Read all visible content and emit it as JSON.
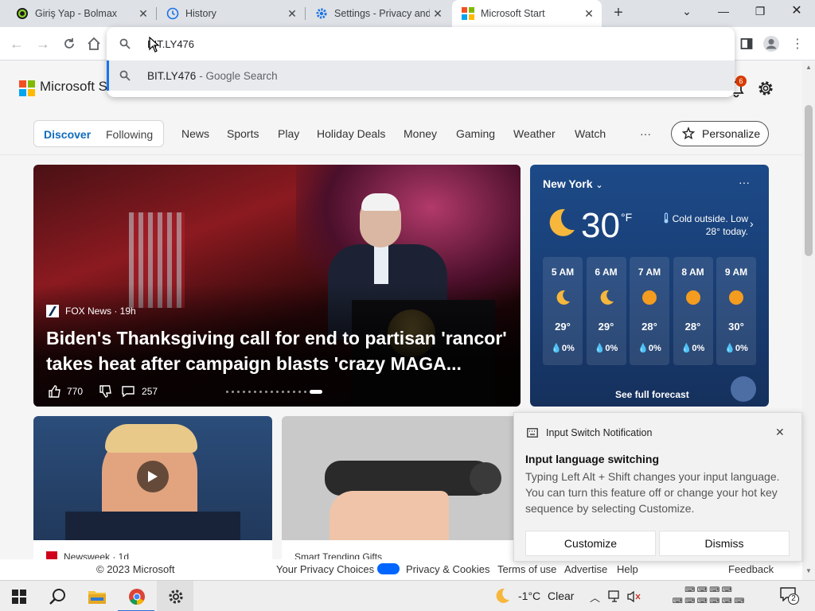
{
  "browser": {
    "tabs": [
      {
        "title": "Giriş Yap - Bolmax",
        "icon": "bolmax-icon"
      },
      {
        "title": "History",
        "icon": "history-icon"
      },
      {
        "title": "Settings - Privacy and",
        "icon": "settings-icon"
      },
      {
        "title": "Microsoft Start",
        "icon": "microsoft-icon",
        "active": true
      }
    ],
    "new_tab": "+",
    "omnibox": {
      "value": "BIT.LY476",
      "suggestion_main": "BIT.LY476",
      "suggestion_sub": "- Google Search"
    }
  },
  "page": {
    "brand": "Microsoft Start",
    "notification_count": "6",
    "nav": {
      "discover": "Discover",
      "following": "Following",
      "links": [
        "News",
        "Sports",
        "Play",
        "Holiday Deals",
        "Money",
        "Gaming",
        "Weather",
        "Watch"
      ],
      "more": "···",
      "personalize": "Personalize"
    },
    "hero": {
      "source": "FOX News · 19h",
      "title": "Biden's Thanksgiving call for end to partisan 'rancor' takes heat after campaign blasts 'crazy MAGA...",
      "likes": "770",
      "comments": "257"
    },
    "weather": {
      "city": "New York",
      "temp": "30",
      "unit": "°F",
      "description": "Cold outside. Low 28° today.",
      "hours": [
        {
          "time": "5 AM",
          "temp": "29°",
          "rain": "0%",
          "icon": "moon-icon"
        },
        {
          "time": "6 AM",
          "temp": "29°",
          "rain": "0%",
          "icon": "moon-icon"
        },
        {
          "time": "7 AM",
          "temp": "28°",
          "rain": "0%",
          "icon": "sun-icon"
        },
        {
          "time": "8 AM",
          "temp": "28°",
          "rain": "0%",
          "icon": "sun-icon"
        },
        {
          "time": "9 AM",
          "temp": "30°",
          "rain": "0%",
          "icon": "sun-icon"
        }
      ],
      "forecast_link": "See full forecast"
    },
    "cards": [
      {
        "source": "Newsweek · 1d"
      },
      {
        "source": "Smart Trending Gifts"
      }
    ],
    "footer": {
      "copyright": "© 2023 Microsoft",
      "privacy_choices": "Your Privacy Choices",
      "privacy_cookies": "Privacy & Cookies",
      "terms": "Terms of use",
      "advertise": "Advertise",
      "help": "Help",
      "feedback": "Feedback"
    }
  },
  "notification": {
    "app": "Input Switch Notification",
    "title": "Input language switching",
    "body": "Typing Left Alt + Shift changes your input language. You can turn this feature off or change your hot key sequence by selecting Customize.",
    "customize": "Customize",
    "dismiss": "Dismiss"
  },
  "taskbar": {
    "temperature": "-1°C",
    "condition": "Clear",
    "notifications": "2"
  },
  "colors": {
    "accent": "#0f6cbd",
    "weather_bg": "#1c4a88",
    "badge": "#d83b01"
  }
}
